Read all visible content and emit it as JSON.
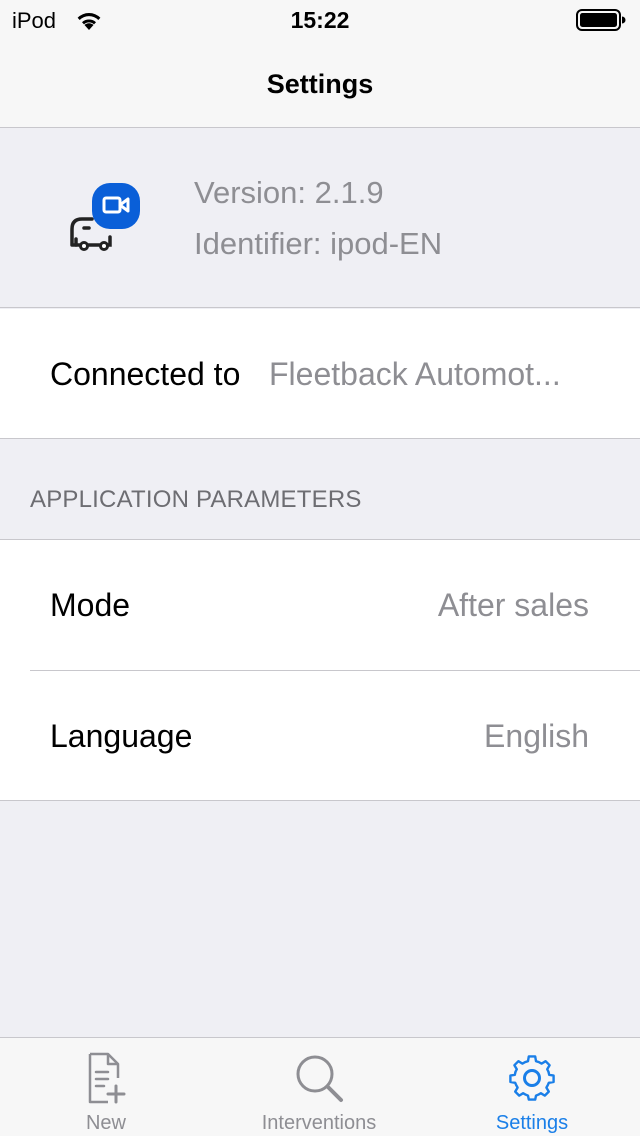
{
  "status_bar": {
    "carrier": "iPod",
    "time": "15:22",
    "wifi_icon": "wifi-icon",
    "battery_icon": "battery-full-icon"
  },
  "nav": {
    "title": "Settings"
  },
  "app_info": {
    "logo_icon": "fleetback-logo-icon",
    "version": "Version: 2.1.9",
    "identifier": "Identifier: ipod-EN",
    "brand_color": "#0a5fd8"
  },
  "connection": {
    "label": "Connected to",
    "value": "Fleetback Automot..."
  },
  "section": {
    "title": "APPLICATION PARAMETERS"
  },
  "parameters": [
    {
      "label": "Mode",
      "value": "After sales"
    },
    {
      "label": "Language",
      "value": "English"
    }
  ],
  "tab_bar": {
    "active_color": "#1a7fe8",
    "inactive_color": "#8e8e93",
    "tabs": [
      {
        "label": "New",
        "icon": "new-document-icon",
        "active": false
      },
      {
        "label": "Interventions",
        "icon": "search-icon",
        "active": false
      },
      {
        "label": "Settings",
        "icon": "gear-icon",
        "active": true
      }
    ]
  }
}
